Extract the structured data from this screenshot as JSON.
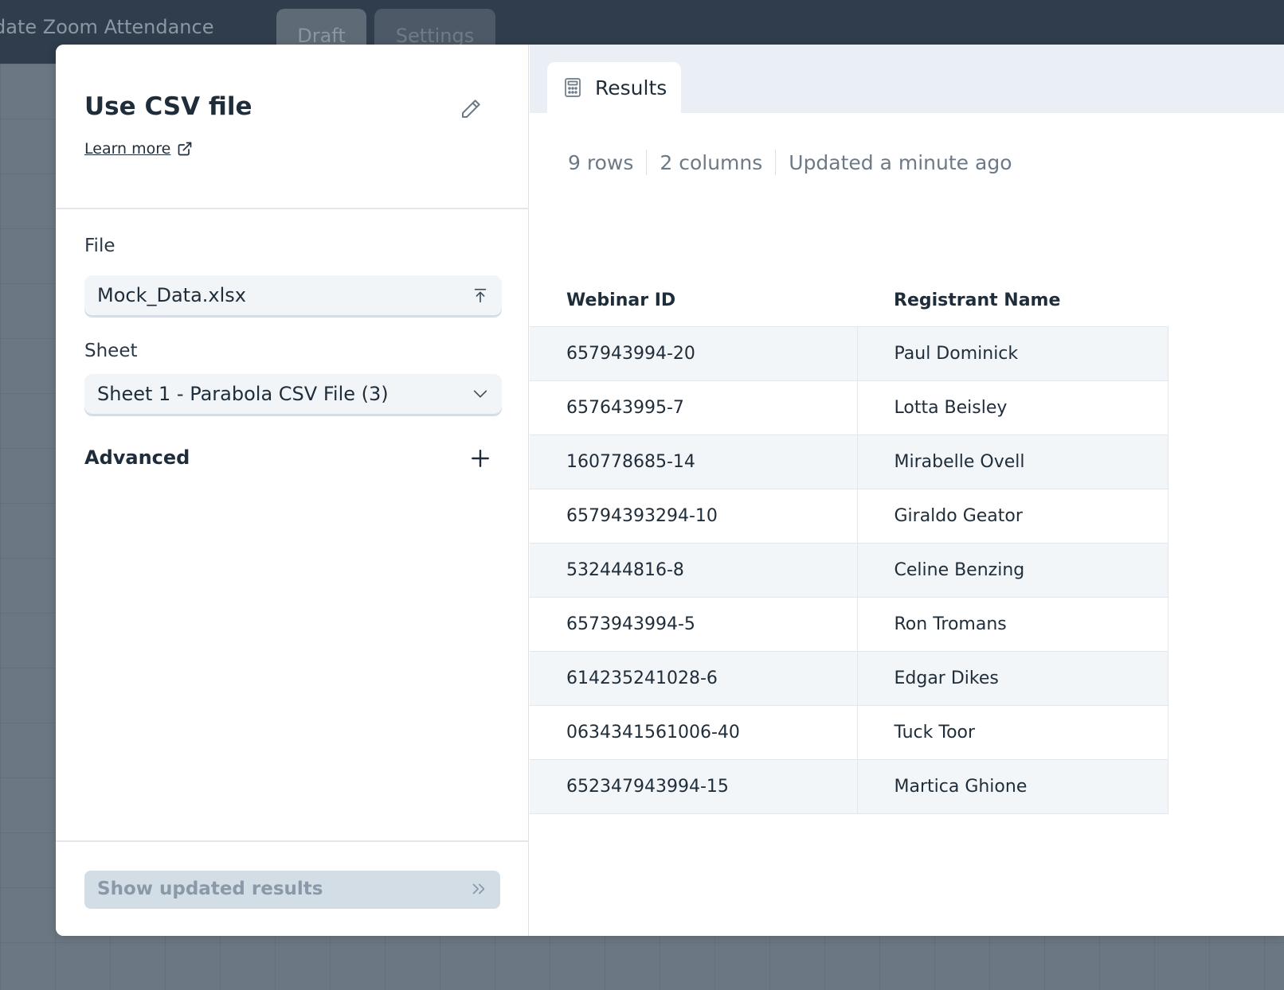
{
  "app": {
    "title": "date Zoom Attendance",
    "tabs": [
      "Draft",
      "Settings"
    ]
  },
  "panel": {
    "title": "Use CSV file",
    "learn_more": "Learn more",
    "file_label": "File",
    "file_value": "Mock_Data.xlsx",
    "sheet_label": "Sheet",
    "sheet_value": "Sheet 1 - Parabola CSV File (3)",
    "advanced_label": "Advanced",
    "show_button": "Show updated results"
  },
  "results": {
    "tab_label": "Results",
    "rows_count": "9 rows",
    "columns_count": "2 columns",
    "updated": "Updated a minute ago",
    "headers": [
      "Webinar ID",
      "Registrant Name"
    ],
    "rows": [
      [
        "657943994-20",
        "Paul Dominick"
      ],
      [
        "657643995-7",
        "Lotta Beisley"
      ],
      [
        "160778685-14",
        "Mirabelle Ovell"
      ],
      [
        "65794393294-10",
        "Giraldo Geator"
      ],
      [
        "532444816-8",
        "Celine Benzing"
      ],
      [
        "6573943994-5",
        "Ron Tromans"
      ],
      [
        "614235241028-6",
        "Edgar Dikes"
      ],
      [
        "0634341561006-40",
        "Tuck Toor"
      ],
      [
        "652347943994-15",
        "Martica Ghione"
      ]
    ]
  },
  "icons": {
    "edit": "pencil-icon",
    "external": "external-link-icon",
    "upload": "upload-icon",
    "dropdown": "chevron-down-icon",
    "expand": "plus-icon",
    "forward": "double-chevron-right-icon",
    "results": "calculator-icon"
  }
}
